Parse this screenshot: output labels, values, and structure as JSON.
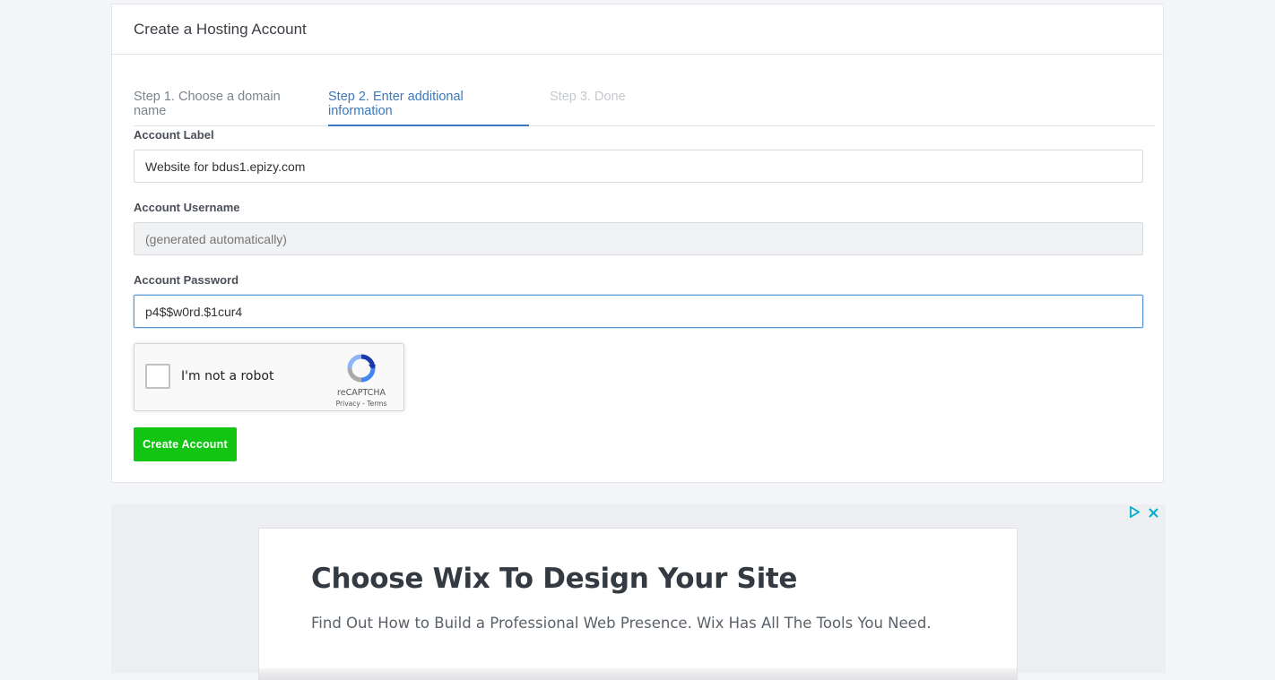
{
  "header": {
    "title": "Create a Hosting Account"
  },
  "steps": [
    {
      "label": "Step 1. Choose a domain name",
      "state": "done"
    },
    {
      "label": "Step 2. Enter additional information",
      "state": "active"
    },
    {
      "label": "Step 3. Done",
      "state": "pending"
    }
  ],
  "form": {
    "account_label": {
      "label": "Account Label",
      "value": "Website for bdus1.epizy.com"
    },
    "account_username": {
      "label": "Account Username",
      "placeholder": "(generated automatically)"
    },
    "account_password": {
      "label": "Account Password",
      "value": "p4$$w0rd.$1cur4"
    },
    "submit_label": "Create Account"
  },
  "captcha": {
    "text": "I'm not a robot",
    "brand": "reCAPTCHA",
    "links": "Privacy - Terms",
    "checked": false
  },
  "ad": {
    "title": "Choose Wix To Design Your Site",
    "description": "Find Out How to Build a Professional Web Presence. Wix Has All The Tools You Need.",
    "icons": [
      "adchoices-icon",
      "close-icon"
    ]
  },
  "colors": {
    "accent": "#3a78bf",
    "button": "#13c513",
    "ad_icon": "#00aecd"
  }
}
